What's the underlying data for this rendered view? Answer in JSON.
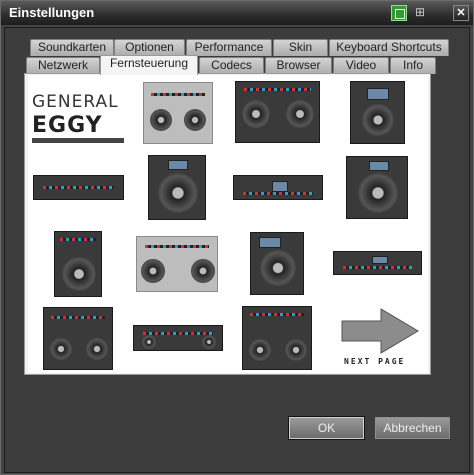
{
  "window": {
    "title": "Einstellungen"
  },
  "tabs_row1": [
    "Soundkarten",
    "Optionen",
    "Performance",
    "Skin",
    "Keyboard Shortcuts"
  ],
  "tabs_row2": [
    "Netzwerk",
    "Fernsteuerung",
    "Codecs",
    "Browser",
    "Video",
    "Info"
  ],
  "active_tab": "Fernsteuerung",
  "logo": {
    "line1": "GENERAL",
    "line2": "EGGY"
  },
  "next_page_label": "NEXT PAGE",
  "buttons": {
    "ok": "OK",
    "cancel": "Abbrechen"
  }
}
